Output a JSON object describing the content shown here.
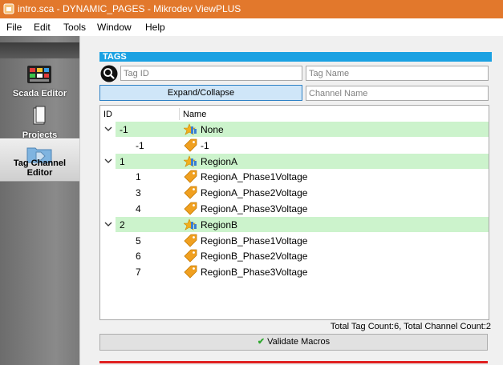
{
  "window": {
    "title": "intro.sca - DYNAMIC_PAGES - Mikrodev ViewPLUS"
  },
  "menu": [
    "File",
    "Edit",
    "Tools",
    "Window",
    "Help"
  ],
  "sidebar": {
    "items": [
      {
        "label": "Scada Editor",
        "icon": "scada-editor-icon"
      },
      {
        "label": "Projects",
        "icon": "projects-icon"
      },
      {
        "label": "Tag Channel Editor",
        "icon": "tag-channel-icon",
        "active": true
      }
    ]
  },
  "tags": {
    "header": "TAGS",
    "tag_id_placeholder": "Tag ID",
    "tag_name_placeholder": "Tag Name",
    "channel_name_placeholder": "Channel Name",
    "expand_label": "Expand/Collapse",
    "columns": {
      "id": "ID",
      "name": "Name"
    },
    "rows": [
      {
        "type": "group",
        "id": "-1",
        "name": "None"
      },
      {
        "type": "tag",
        "id": "-1",
        "name": "-1"
      },
      {
        "type": "group",
        "id": "1",
        "name": "RegionA"
      },
      {
        "type": "tag",
        "id": "1",
        "name": "RegionA_Phase1Voltage"
      },
      {
        "type": "tag",
        "id": "3",
        "name": "RegionA_Phase2Voltage"
      },
      {
        "type": "tag",
        "id": "4",
        "name": "RegionA_Phase3Voltage"
      },
      {
        "type": "group",
        "id": "2",
        "name": "RegionB"
      },
      {
        "type": "tag",
        "id": "5",
        "name": "RegionB_Phase1Voltage"
      },
      {
        "type": "tag",
        "id": "6",
        "name": "RegionB_Phase2Voltage"
      },
      {
        "type": "tag",
        "id": "7",
        "name": "RegionB_Phase3Voltage"
      }
    ],
    "summary": "Total Tag Count:6, Total Channel Count:2",
    "validate_label": "Validate Macros"
  },
  "colors": {
    "titlebar": "#e2782c",
    "header_blue": "#1ba1e2",
    "group_row": "#ccf3cc",
    "tag_icon": "#f0a020"
  }
}
